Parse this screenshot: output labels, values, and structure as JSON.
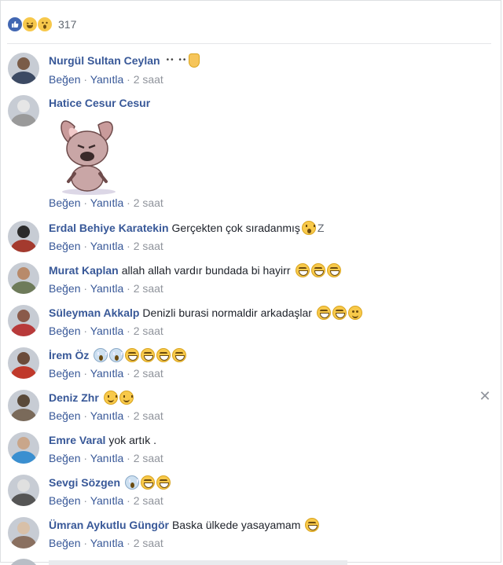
{
  "reactions": {
    "icons": [
      "like-icon",
      "haha-icon",
      "wow-icon"
    ],
    "count": "317"
  },
  "comments": [
    {
      "author": "Nurgül Sultan Ceylan",
      "text": "",
      "extra": "•• •• ",
      "emojis": [
        "hand"
      ],
      "actions": {
        "like": "Beğen",
        "reply": "Yanıtla",
        "time": "2 saat"
      }
    },
    {
      "author": "Hatice Cesur Cesur",
      "text": "",
      "sticker": "bunny-sticker",
      "actions": {
        "like": "Beğen",
        "reply": "Yanıtla",
        "time": "2 saat"
      }
    },
    {
      "author": "Erdal Behiye Karatekin",
      "text": "Gerçekten çok sıradanmış",
      "emojis": [
        "wow"
      ],
      "trail": "Z",
      "actions": {
        "like": "Beğen",
        "reply": "Yanıtla",
        "time": "2 saat"
      }
    },
    {
      "author": "Murat Kaplan",
      "text": "allah allah vardır bundada bi hayirr",
      "emojis": [
        "grin",
        "grin",
        "grin"
      ],
      "actions": {
        "like": "Beğen",
        "reply": "Yanıtla",
        "time": "2 saat"
      }
    },
    {
      "author": "Süleyman Akkalp",
      "text": "Denizli burasi normaldir arkadaşlar",
      "emojis": [
        "grin",
        "grin",
        "wink"
      ],
      "actions": {
        "like": "Beğen",
        "reply": "Yanıtla",
        "time": "2 saat"
      }
    },
    {
      "author": "İrem Öz",
      "text": "",
      "emojis": [
        "scream",
        "scream",
        "grin",
        "grin",
        "grin",
        "grin"
      ],
      "actions": {
        "like": "Beğen",
        "reply": "Yanıtla",
        "time": "2 saat"
      }
    },
    {
      "author": "Deniz Zhr",
      "text": "",
      "emojis": [
        "smile",
        "smile"
      ],
      "actions": {
        "like": "Beğen",
        "reply": "Yanıtla",
        "time": "2 saat"
      }
    },
    {
      "author": "Emre Varal",
      "text": "yok artık .",
      "emojis": [],
      "actions": {
        "like": "Beğen",
        "reply": "Yanıtla",
        "time": "2 saat"
      }
    },
    {
      "author": "Sevgi Sözgen",
      "text": "",
      "emojis": [
        "scream",
        "grin",
        "grin"
      ],
      "actions": {
        "like": "Beğen",
        "reply": "Yanıtla",
        "time": "2 saat"
      }
    },
    {
      "author": "Ümran Aykutlu Güngör",
      "text": "Baska ülkede yasayamam",
      "emojis": [
        "grin"
      ],
      "actions": {
        "like": "Beğen",
        "reply": "Yanıtla",
        "time": "2 saat"
      }
    }
  ],
  "separator": "·",
  "close_icon": "close-icon"
}
